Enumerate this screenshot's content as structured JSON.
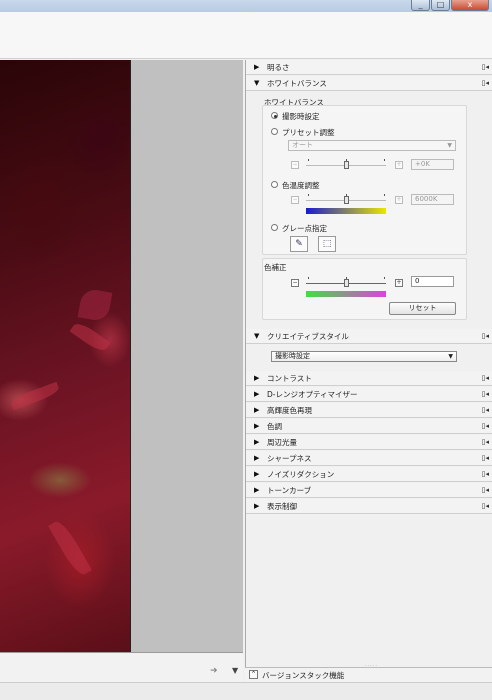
{
  "window": {
    "min": "_",
    "max": "□",
    "close": "x"
  },
  "sections": {
    "brightness": "明るさ",
    "white_balance": "ホワイトバランス",
    "creative_style": "クリエイティブスタイル",
    "contrast": "コントラスト",
    "d_range": "D-レンジオプティマイザー",
    "hdr_color": "高輝度色再現",
    "tone": "色調",
    "vignette": "周辺光量",
    "sharpness": "シャープネス",
    "noise": "ノイズリダクション",
    "tone_curve": "トーンカーブ",
    "display": "表示制御"
  },
  "wb": {
    "group_label": "ホワイトバランス",
    "as_shot": "撮影時設定",
    "preset": "プリセット調整",
    "preset_value": "オート",
    "preset_adjust": "+0K",
    "color_temp": "色温度調整",
    "color_temp_value": "6000K",
    "gray_point": "グレー点指定"
  },
  "color_correction": {
    "label": "色補正",
    "value": "0",
    "reset": "リセット"
  },
  "creative_style_value": "撮影時設定",
  "version_stack": "バージョンスタック機能",
  "icons": {
    "expanded": "▼",
    "collapsed": "▶",
    "pin": "▯◂",
    "minus": "−",
    "plus": "+",
    "dropdown": "▼",
    "eyedropper": "✎",
    "select": "⬚",
    "arrow_right": "➜",
    "arrow_down": "▼",
    "collapse_up": "⌃"
  },
  "colors": {
    "temp_gradient": [
      "#1a1ad0",
      "#e8e800"
    ],
    "tint_gradient": [
      "#40e040",
      "#e040e0"
    ]
  }
}
